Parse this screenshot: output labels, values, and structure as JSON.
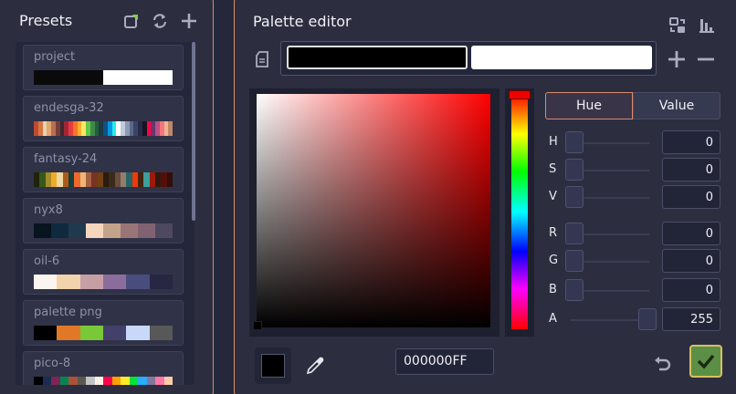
{
  "presets": {
    "title": "Presets",
    "icons": [
      "new-palette-icon",
      "refresh-icon",
      "add-icon"
    ],
    "items": [
      {
        "name": "project",
        "colors": [
          "#0a0a0a",
          "#0a0a0a",
          "#0a0a0a",
          "#0a0a0a",
          "#ffffff",
          "#ffffff",
          "#ffffff",
          "#ffffff"
        ]
      },
      {
        "name": "endesga-32",
        "colors": [
          "#be4a2f",
          "#d77643",
          "#ead4aa",
          "#e4a672",
          "#b86f50",
          "#733e39",
          "#3e2731",
          "#a22633",
          "#e43b44",
          "#f77622",
          "#feae34",
          "#fee761",
          "#63c74d",
          "#3e8948",
          "#265c42",
          "#193c3e",
          "#124e89",
          "#0099db",
          "#2ce8f5",
          "#ffffff",
          "#c0cbdc",
          "#8b9bb4",
          "#5a6988",
          "#3a4466",
          "#262b44",
          "#181425",
          "#ff0044",
          "#68386c",
          "#b55088",
          "#f6757a",
          "#e8b796",
          "#c28569"
        ]
      },
      {
        "name": "fantasy-24",
        "colors": [
          "#1f240a",
          "#39571c",
          "#a58c27",
          "#efac28",
          "#efd8a1",
          "#ab5c1c",
          "#183f39",
          "#ef692f",
          "#efb775",
          "#a56243",
          "#773421",
          "#724113",
          "#2a1d0d",
          "#392a1c",
          "#684c3c",
          "#927e6a",
          "#276468",
          "#ef3a0c",
          "#45230d",
          "#3c9f9c",
          "#9b1a0a",
          "#36170c",
          "#550f0a",
          "#300f0a"
        ]
      },
      {
        "name": "nyx8",
        "colors": [
          "#08141e",
          "#0f2a3f",
          "#20394f",
          "#f6d6bd",
          "#c3a38a",
          "#997577",
          "#816271",
          "#4e495f"
        ]
      },
      {
        "name": "oil-6",
        "colors": [
          "#fbf5ef",
          "#f2d3ab",
          "#c69fa5",
          "#8b6d9c",
          "#494d7e",
          "#272744"
        ]
      },
      {
        "name": "palette png",
        "colors": [
          "#000000",
          "#e07828",
          "#78c838",
          "#44406c",
          "#c8d8f8",
          "#585858"
        ]
      },
      {
        "name": "pico-8",
        "colors": [
          "#000000",
          "#1d2b53",
          "#7e2553",
          "#008751",
          "#ab5236",
          "#5f574f",
          "#c2c3c7",
          "#fff1e8",
          "#ff004d",
          "#ffa300",
          "#ffec27",
          "#00e436",
          "#29adff",
          "#83769c",
          "#ff77a8",
          "#ffccaa"
        ]
      }
    ]
  },
  "editor": {
    "title": "Palette editor",
    "primary_color": "#000000",
    "secondary_color": "#ffffff",
    "picker_hue_color": "#ff0000",
    "mode_buttons": {
      "hue": "Hue",
      "value": "Value"
    },
    "sliders": [
      {
        "label": "H",
        "value": "0",
        "fraction": 0
      },
      {
        "label": "S",
        "value": "0",
        "fraction": 0
      },
      {
        "label": "V",
        "value": "0",
        "fraction": 0
      },
      {
        "label": "R",
        "value": "0",
        "fraction": 0
      },
      {
        "label": "G",
        "value": "0",
        "fraction": 0
      },
      {
        "label": "B",
        "value": "0",
        "fraction": 0
      },
      {
        "label": "A",
        "value": "255",
        "fraction": 1
      }
    ],
    "hex_value": "000000FF",
    "accent_color": "#d98a6a",
    "confirm_color": "#5b8f45"
  }
}
